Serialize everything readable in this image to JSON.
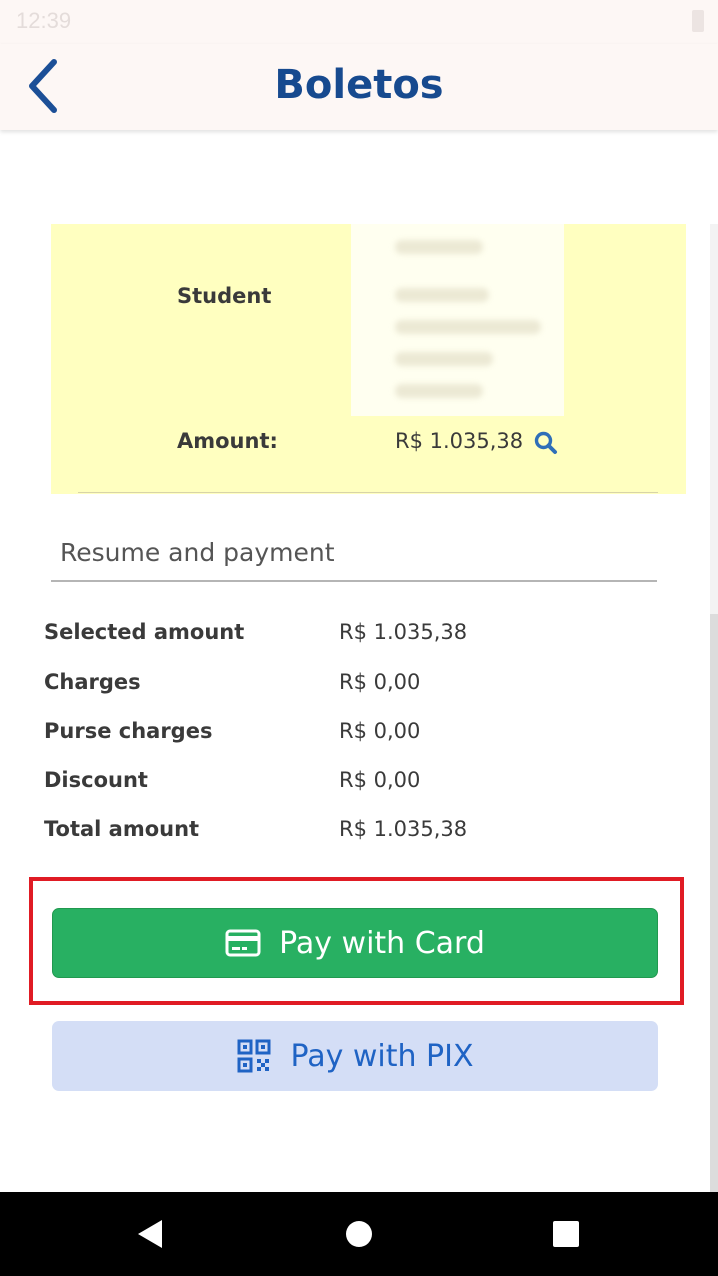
{
  "status_bar": {
    "time": "12:39"
  },
  "header": {
    "title": "Boletos"
  },
  "student_card": {
    "student_label": "Student",
    "amount_label": "Amount:",
    "amount_value": "R$ 1.035,38"
  },
  "resume": {
    "heading": "Resume and payment"
  },
  "summary": [
    {
      "label": "Selected amount",
      "value": "R$ 1.035,38"
    },
    {
      "label": "Charges",
      "value": "R$ 0,00"
    },
    {
      "label": "Purse charges",
      "value": "R$ 0,00"
    },
    {
      "label": "Discount",
      "value": "R$ 0,00"
    },
    {
      "label": "Total amount",
      "value": "R$ 1.035,38"
    }
  ],
  "buttons": {
    "pay_card": "Pay with Card",
    "pay_pix": "Pay with PIX"
  },
  "colors": {
    "title": "#174a8f",
    "card_bg": "#ffffc0",
    "pay_card_bg": "#28b062",
    "pay_pix_bg": "#d4def6",
    "pay_pix_text": "#1f63c4",
    "highlight_border": "#e01b24"
  },
  "icons": {
    "back": "chevron-left-icon",
    "search": "search-icon",
    "card": "credit-card-icon",
    "pix": "qr-code-icon"
  }
}
